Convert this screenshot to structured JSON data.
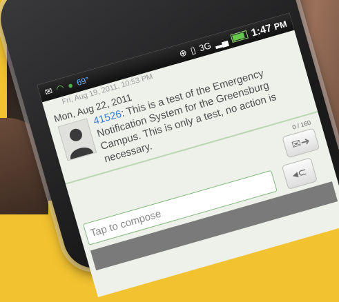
{
  "status_bar": {
    "temperature": "69°",
    "network": "3G",
    "time": "1:47",
    "time_suffix": "PM"
  },
  "conversation": {
    "previous_date": "Fri, Aug 19, 2011, 10:53 PM",
    "date_header": "Mon, Aug 22, 2011",
    "message": {
      "sender": "41526",
      "text": "This is a test of the Emergency Notification System for the Greensburg Campus. This is only a test, no action is necessary."
    }
  },
  "compose": {
    "counter": "0 / 160",
    "placeholder": "Tap to compose"
  }
}
